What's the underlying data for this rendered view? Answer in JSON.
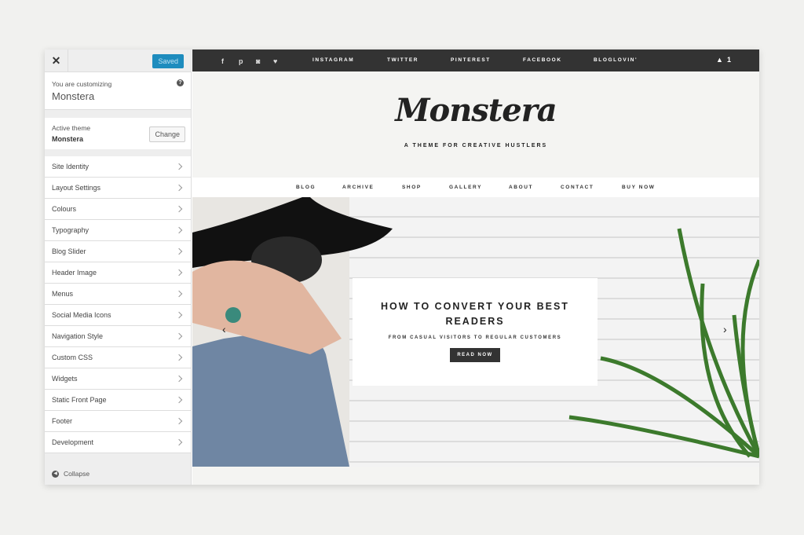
{
  "sidebar": {
    "saved_label": "Saved",
    "customizing_label": "You are customizing",
    "site_name": "Monstera",
    "active_theme_label": "Active theme",
    "theme_name": "Monstera",
    "change_label": "Change",
    "items": [
      "Site Identity",
      "Layout Settings",
      "Colours",
      "Typography",
      "Blog Slider",
      "Header Image",
      "Menus",
      "Social Media Icons",
      "Navigation Style",
      "Custom CSS",
      "Widgets",
      "Static Front Page",
      "Footer",
      "Development"
    ],
    "collapse_label": "Collapse"
  },
  "preview": {
    "top_links": [
      "INSTAGRAM",
      "TWITTER",
      "PINTEREST",
      "FACEBOOK",
      "BLOGLOVIN'"
    ],
    "cart_count": "1",
    "logo": "Monstera",
    "tagline": "A THEME FOR CREATIVE HUSTLERS",
    "nav": [
      "BLOG",
      "ARCHIVE",
      "SHOP",
      "GALLERY",
      "ABOUT",
      "CONTACT",
      "BUY NOW"
    ],
    "slide": {
      "title": "HOW TO CONVERT YOUR BEST READERS",
      "subtitle": "FROM CASUAL VISITORS TO REGULAR CUSTOMERS",
      "button": "READ NOW"
    }
  },
  "colors": {
    "accent": "#1e8cbe",
    "topbar": "#333333"
  }
}
